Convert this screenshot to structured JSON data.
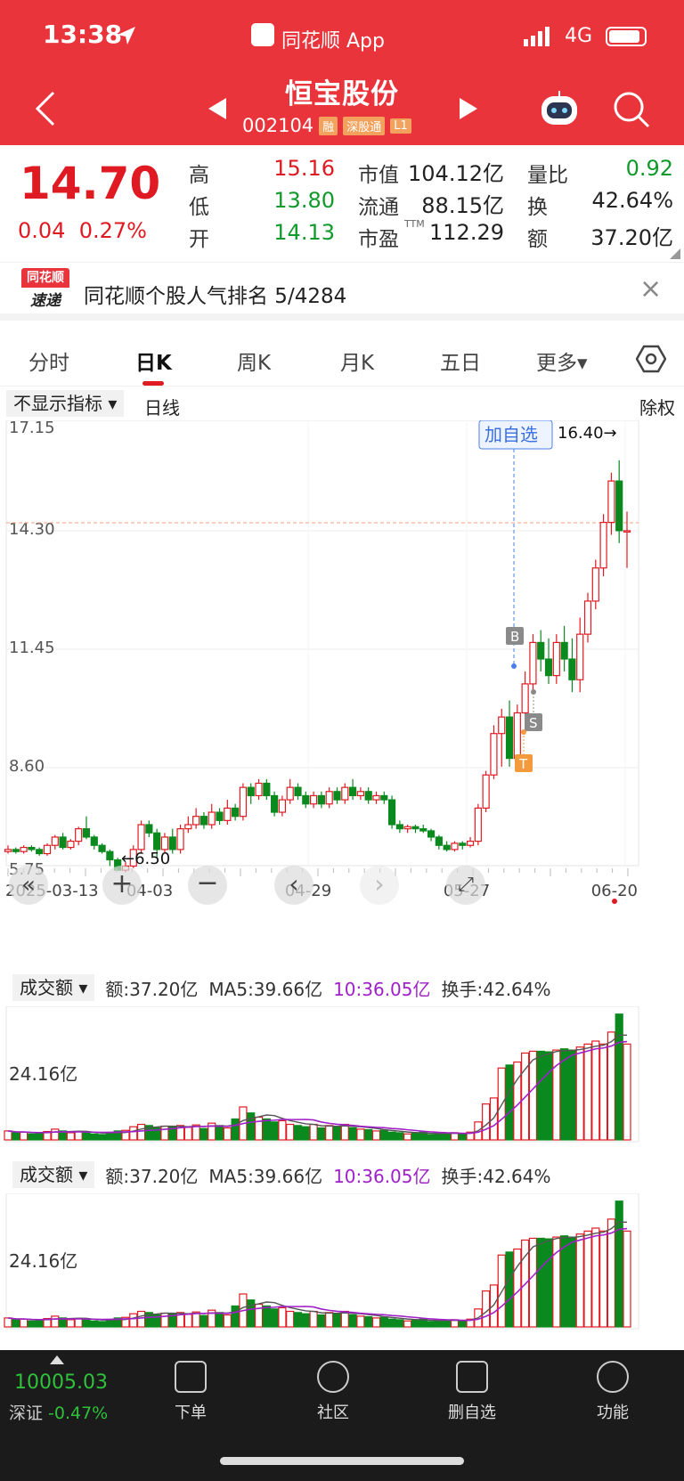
{
  "status": {
    "time": "13:38",
    "app": "同花顺 App",
    "network": "4G"
  },
  "stock": {
    "name": "恒宝股份",
    "code": "002104",
    "tags": [
      "融",
      "深股通",
      "L1"
    ]
  },
  "quote": {
    "price": "14.70",
    "change": "0.04",
    "change_pct": "0.27%",
    "high_label": "高",
    "high": "15.16",
    "low_label": "低",
    "low": "13.80",
    "open_label": "开",
    "open": "14.13",
    "mcap_label": "市值",
    "mcap": "104.12亿",
    "float_label": "流通",
    "float": "88.15亿",
    "pe_label": "市盈",
    "pe_sup": "TTM",
    "pe": "112.29",
    "vr_label": "量比",
    "vr": "0.92",
    "turnover_label": "换",
    "turnover": "42.64%",
    "amount_label": "额",
    "amount": "37.20亿"
  },
  "banner": {
    "logo_top": "同花顺",
    "logo_bottom": "速递",
    "text": "同花顺个股人气排名 5/4284",
    "close": "×"
  },
  "tabs": [
    "分时",
    "日K",
    "周K",
    "月K",
    "五日",
    "更多▾"
  ],
  "indicator": {
    "select": "不显示指标 ▾",
    "name": "日线",
    "right": "除权"
  },
  "kline": {
    "y_labels": [
      "17.15",
      "14.30",
      "11.45",
      "8.60",
      "5.75"
    ],
    "x_labels": [
      "2025-03-13",
      "04-03",
      "04-29",
      "05-27",
      "06-20"
    ],
    "max_note": "16.40→",
    "min_note": "←6.50",
    "add_watch": "加自选",
    "markers": [
      "B",
      "S",
      "T"
    ],
    "colors": {
      "up": "#e01a22",
      "down": "#0a8a1e"
    }
  },
  "volume_panels": [
    {
      "select": "成交额 ▾",
      "amount": "额:37.20亿",
      "ma5": "MA5:39.66亿",
      "ma10": "10:36.05亿",
      "turnover": "换手:42.64%",
      "axis": "24.16亿"
    },
    {
      "select": "成交额 ▾",
      "amount": "额:37.20亿",
      "ma5": "MA5:39.66亿",
      "ma10": "10:36.05亿",
      "turnover": "换手:42.64%",
      "axis": "24.16亿"
    }
  ],
  "bottom": {
    "index_value": "10005.03",
    "index_name": "深证",
    "index_chg": "-0.47%",
    "items": [
      "下单",
      "社区",
      "删自选",
      "功能"
    ]
  }
}
